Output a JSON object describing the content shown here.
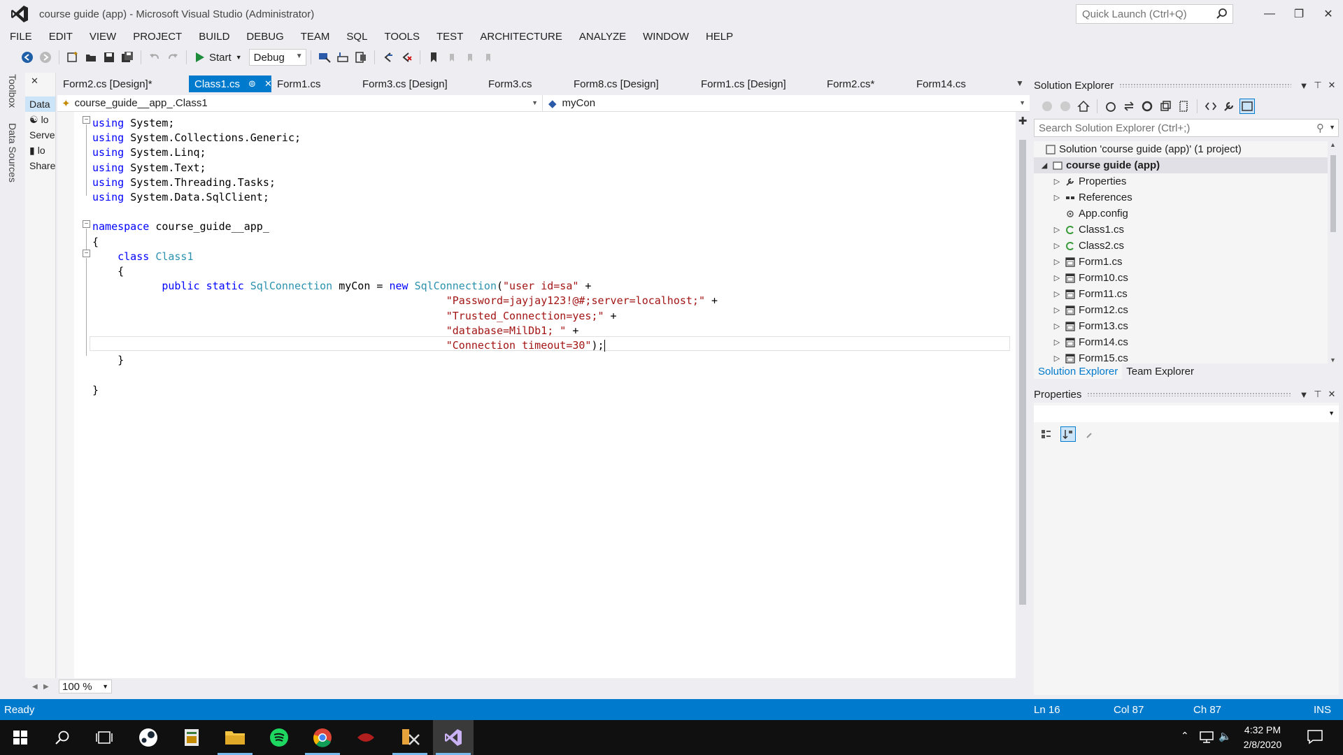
{
  "window": {
    "title": "course guide (app) - Microsoft Visual Studio (Administrator)",
    "quick_launch_placeholder": "Quick Launch (Ctrl+Q)"
  },
  "menu": [
    "FILE",
    "EDIT",
    "VIEW",
    "PROJECT",
    "BUILD",
    "DEBUG",
    "TEAM",
    "SQL",
    "TOOLS",
    "TEST",
    "ARCHITECTURE",
    "ANALYZE",
    "WINDOW",
    "HELP"
  ],
  "toolbar": {
    "start_label": "Start",
    "config_value": "Debug"
  },
  "left_strip": {
    "toolbox": "Toolbox",
    "data_sources": "Data Sources"
  },
  "data_panel": {
    "title": "Data",
    "items": [
      "lo",
      "Serve",
      "lo",
      "Share"
    ]
  },
  "doc_tabs": [
    {
      "label": "Form2.cs [Design]*"
    },
    {
      "label": "Class1.cs",
      "active": true
    },
    {
      "label": "Form1.cs"
    },
    {
      "label": "Form3.cs [Design]"
    },
    {
      "label": "Form3.cs"
    },
    {
      "label": "Form8.cs [Design]"
    },
    {
      "label": "Form1.cs [Design]"
    },
    {
      "label": "Form2.cs*"
    },
    {
      "label": "Form14.cs"
    }
  ],
  "nav": {
    "left": "course_guide__app_.Class1",
    "right": "myCon"
  },
  "code": {
    "usings": [
      "System;",
      "System.Collections.Generic;",
      "System.Linq;",
      "System.Text;",
      "System.Threading.Tasks;",
      "System.Data.SqlClient;"
    ],
    "kw_using": "using",
    "kw_namespace": "namespace",
    "namespace_name": "course_guide__app_",
    "kw_class": "class",
    "class_name": "Class1",
    "kw_public": "public",
    "kw_static": "static",
    "type_sql": "SqlConnection",
    "field": "myCon",
    "kw_new": "new",
    "str1": "\"user id=sa\"",
    "str2": "\"Password=jayjay123!@#;server=localhost;\"",
    "str3": "\"Trusted_Connection=yes;\"",
    "str4": "\"database=MilDb1; \"",
    "str5": "\"Connection timeout=30\""
  },
  "editor": {
    "zoom": "100 %"
  },
  "solution_explorer": {
    "title": "Solution Explorer",
    "search_placeholder": "Search Solution Explorer (Ctrl+;)",
    "solution": "Solution 'course guide (app)' (1 project)",
    "project": "course guide (app)",
    "items": [
      {
        "label": "Properties",
        "icon": "wrench-icon",
        "expandable": true
      },
      {
        "label": "References",
        "icon": "references-icon",
        "expandable": true
      },
      {
        "label": "App.config",
        "icon": "config-icon",
        "expandable": false
      },
      {
        "label": "Class1.cs",
        "icon": "class-icon",
        "expandable": true
      },
      {
        "label": "Class2.cs",
        "icon": "class-icon",
        "expandable": true
      },
      {
        "label": "Form1.cs",
        "icon": "form-icon",
        "expandable": true
      },
      {
        "label": "Form10.cs",
        "icon": "form-icon",
        "expandable": true
      },
      {
        "label": "Form11.cs",
        "icon": "form-icon",
        "expandable": true
      },
      {
        "label": "Form12.cs",
        "icon": "form-icon",
        "expandable": true
      },
      {
        "label": "Form13.cs",
        "icon": "form-icon",
        "expandable": true
      },
      {
        "label": "Form14.cs",
        "icon": "form-icon",
        "expandable": true
      },
      {
        "label": "Form15.cs",
        "icon": "form-icon",
        "expandable": true
      }
    ],
    "tabs": [
      "Solution Explorer",
      "Team Explorer"
    ]
  },
  "properties": {
    "title": "Properties"
  },
  "status": {
    "state": "Ready",
    "ln": "Ln 16",
    "col": "Col 87",
    "ch": "Ch 87",
    "mode": "INS"
  },
  "taskbar": {
    "time": "4:32 PM",
    "date": "2/8/2020"
  },
  "colors": {
    "accent": "#007acc",
    "keyword": "#0000ff",
    "type": "#2b91af",
    "string": "#a31515"
  }
}
